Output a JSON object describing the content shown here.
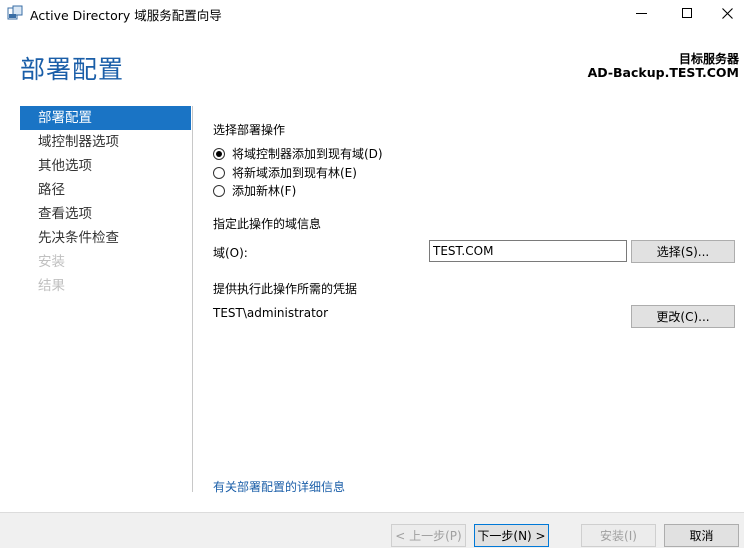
{
  "window": {
    "title": "Active Directory 域服务配置向导"
  },
  "header": {
    "page_title": "部署配置",
    "target_server_label": "目标服务器",
    "target_server_name": "AD-Backup.TEST.COM"
  },
  "nav": {
    "items": [
      {
        "label": "部署配置",
        "state": "active"
      },
      {
        "label": "域控制器选项",
        "state": "normal"
      },
      {
        "label": "其他选项",
        "state": "normal"
      },
      {
        "label": "路径",
        "state": "normal"
      },
      {
        "label": "查看选项",
        "state": "normal"
      },
      {
        "label": "先决条件检查",
        "state": "normal"
      },
      {
        "label": "安装",
        "state": "disabled"
      },
      {
        "label": "结果",
        "state": "disabled"
      }
    ]
  },
  "main": {
    "operation_heading": "选择部署操作",
    "options": [
      {
        "label": "将域控制器添加到现有域(D)",
        "checked": true
      },
      {
        "label": "将新域添加到现有林(E)",
        "checked": false
      },
      {
        "label": "添加新林(F)",
        "checked": false
      }
    ],
    "domain_info_heading": "指定此操作的域信息",
    "domain_label": "域(O):",
    "domain_value": "TEST.COM",
    "select_button": "选择(S)...",
    "credentials_heading": "提供执行此操作所需的凭据",
    "credentials_value": "TEST\\administrator",
    "change_button": "更改(C)...",
    "more_info_link": "有关部署配置的详细信息"
  },
  "footer": {
    "prev_button": "< 上一步(P)",
    "next_button": "下一步(N) >",
    "install_button": "安装(I)",
    "cancel_button": "取消"
  }
}
